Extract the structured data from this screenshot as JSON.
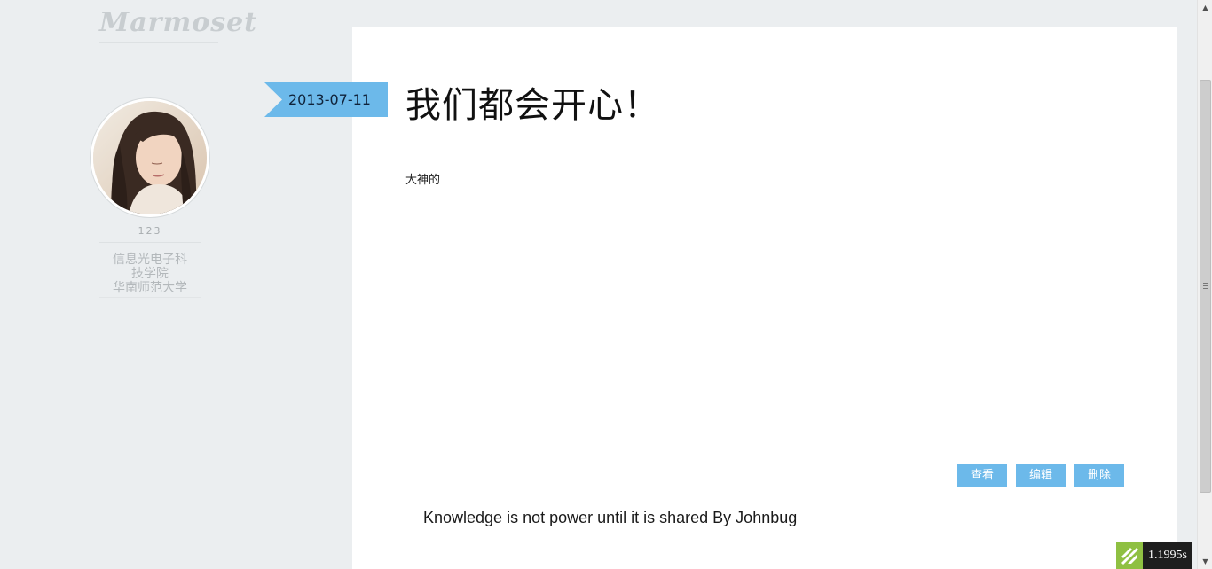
{
  "sidebar": {
    "logo": "Marmoset",
    "user_id": "123",
    "dept_line1": "信息光电子科",
    "dept_line2": "技学院",
    "school": "华南师范大学"
  },
  "post": {
    "date": "2013-07-11",
    "title": "我们都会开心！",
    "body": "大神的",
    "actions": {
      "view": "查看",
      "edit": "编辑",
      "delete": "删除"
    }
  },
  "footer": {
    "quote": "Knowledge is not power until it is shared By Johnbug"
  },
  "timer": {
    "value": "1.1995s"
  },
  "colors": {
    "accent": "#6cb9ea",
    "background": "#ebeef0",
    "card": "#ffffff",
    "timer_logo": "#8fc042"
  }
}
